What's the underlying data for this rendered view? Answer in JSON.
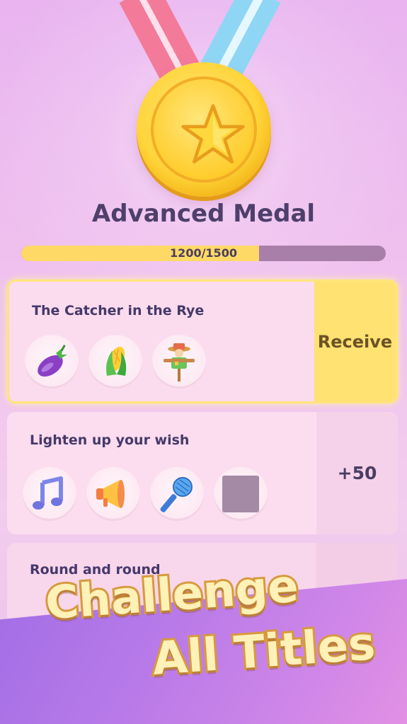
{
  "medal": {
    "title": "Advanced Medal",
    "progress_text": "1200/1500",
    "progress_fraction": 0.653
  },
  "challenges": [
    {
      "title": "The Catcher in the Rye",
      "action_label": "Receive",
      "items": [
        "eggplant-icon",
        "corn-icon",
        "scarecrow-icon"
      ]
    },
    {
      "title": "Lighten up your wish",
      "action_label": "+50",
      "items": [
        "music-note-icon",
        "megaphone-icon",
        "microphone-icon",
        "locked-item"
      ]
    },
    {
      "title": "Round and round",
      "action_label": "",
      "items": []
    }
  ],
  "banner": {
    "line1": "Challenge",
    "line2": "All Titles"
  },
  "colors": {
    "accent_gold": "#ffe272",
    "progress_fill": "#ffd966",
    "progress_track": "#a77fa8",
    "title_text": "#4e3f6b"
  }
}
